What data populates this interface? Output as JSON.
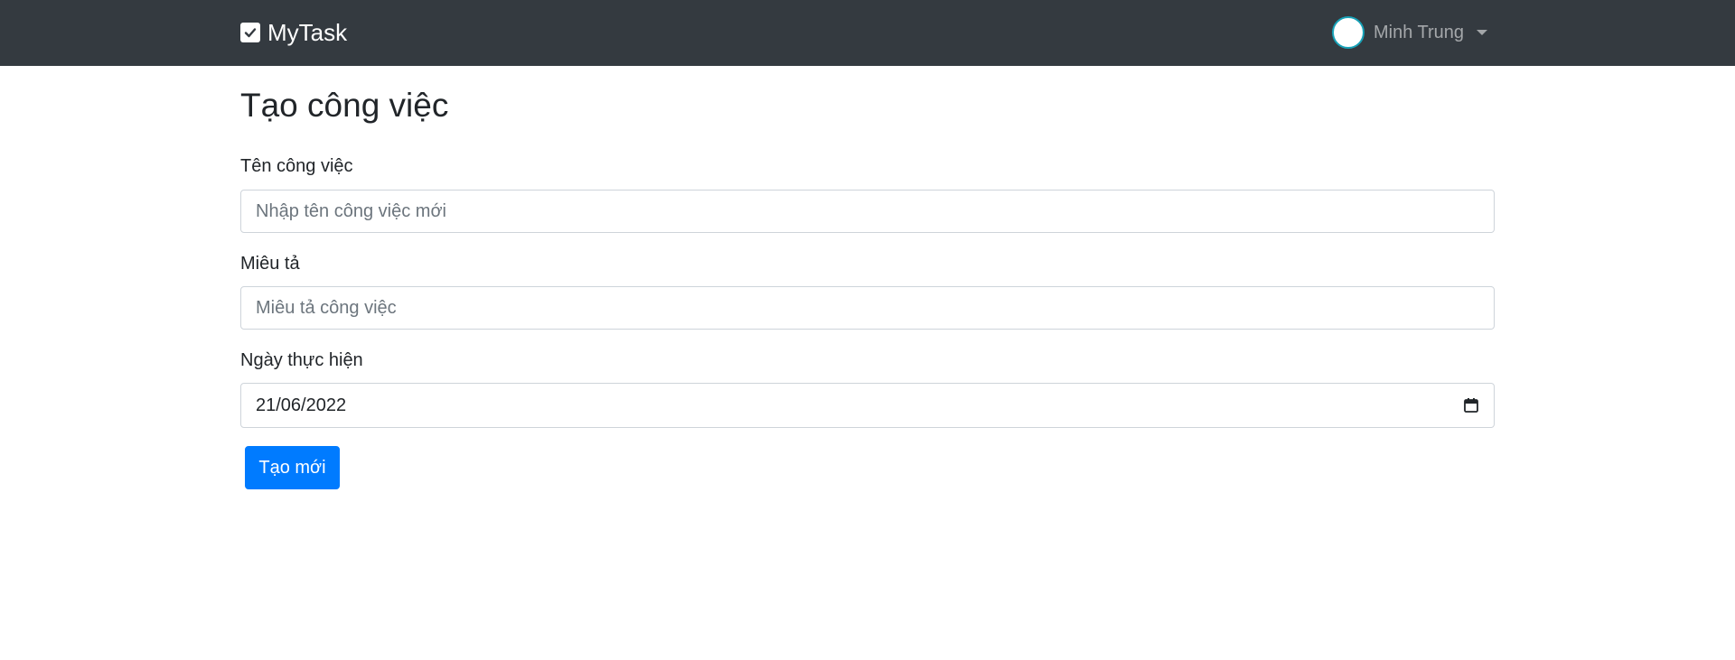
{
  "navbar": {
    "brand": "MyTask",
    "brand_icon": "check-square-icon",
    "user_name": "Minh Trung",
    "bg_color": "#343a40"
  },
  "form": {
    "title": "Tạo công việc",
    "name_label": "Tên công việc",
    "name_placeholder": "Nhập tên công việc mới",
    "name_value": "",
    "desc_label": "Miêu tả",
    "desc_placeholder": "Miêu tả công việc",
    "desc_value": "",
    "date_label": "Ngày thực hiện",
    "date_value": "21/06/2022",
    "submit_label": "Tạo mới",
    "submit_color": "#007bff"
  }
}
